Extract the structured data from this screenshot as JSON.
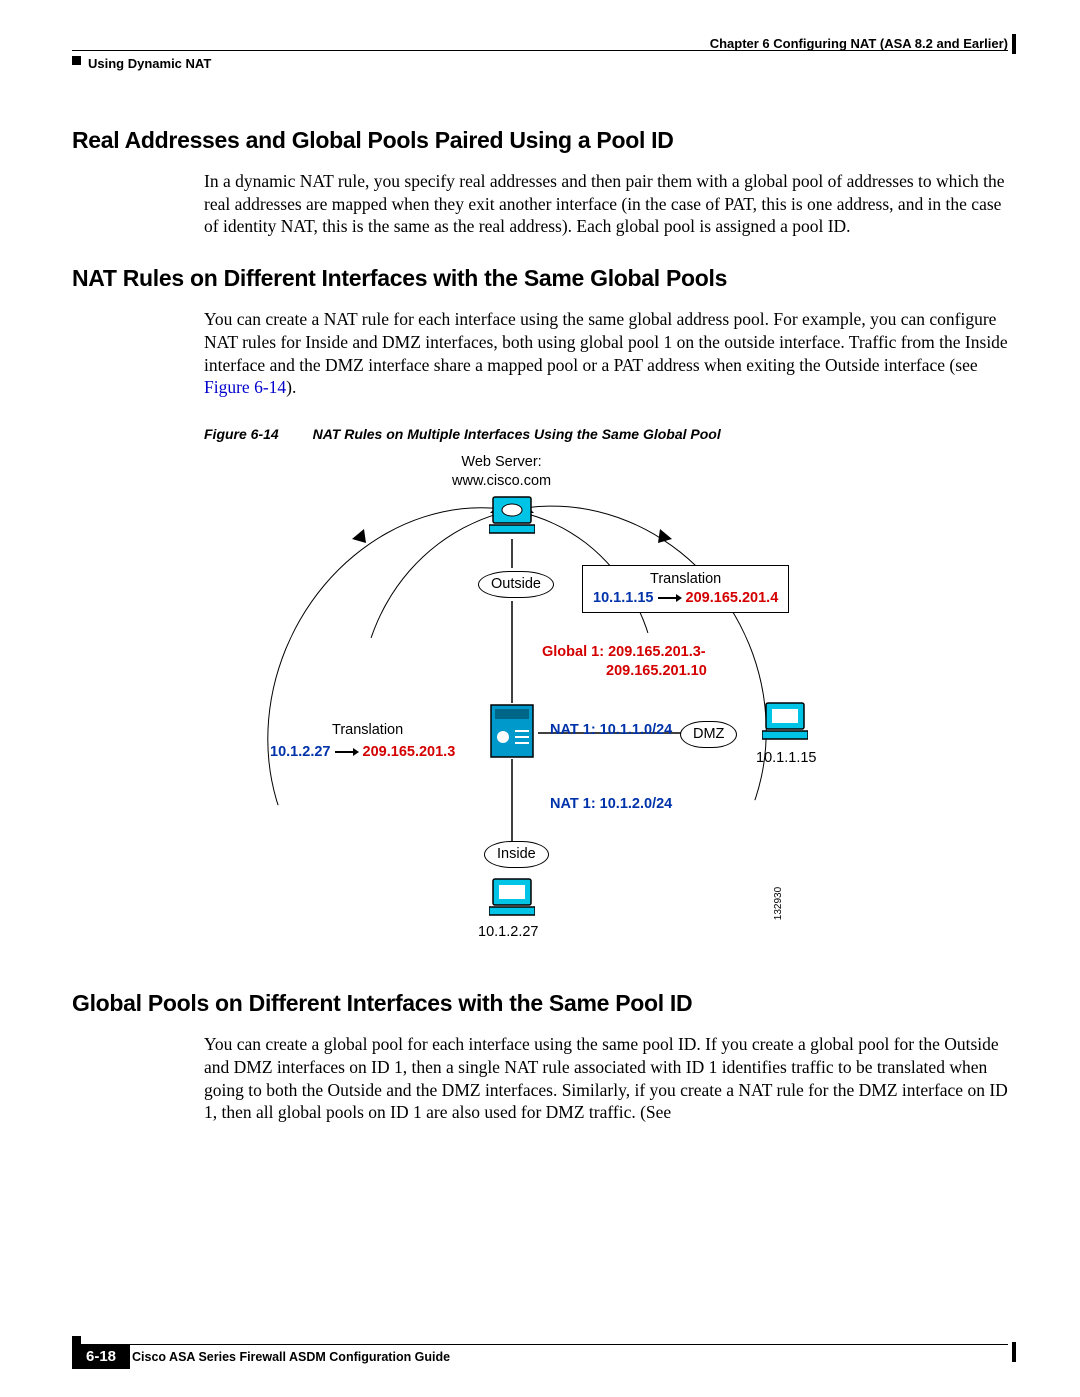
{
  "header": {
    "chapter": "Chapter 6      Configuring NAT (ASA 8.2 and Earlier)",
    "section": "Using Dynamic NAT"
  },
  "sections": {
    "s1": {
      "title": "Real Addresses and Global Pools Paired Using a Pool ID",
      "body": "In a dynamic NAT rule, you specify real addresses and then pair them with a global pool of addresses to which the real addresses are mapped when they exit another interface (in the case of PAT, this is one address, and in the case of identity NAT, this is the same as the real address). Each global pool is assigned a pool ID."
    },
    "s2": {
      "title": "NAT Rules on Different Interfaces with the Same Global Pools",
      "body_pre": "You can create a NAT rule for each interface using the same global address pool. For example, you can configure NAT rules for Inside and DMZ interfaces, both using global pool 1 on the outside interface. Traffic from the Inside interface and the DMZ interface share a mapped pool or a PAT address when exiting the Outside interface (see ",
      "body_link": "Figure 6-14",
      "body_post": ")."
    },
    "figure": {
      "num": "Figure 6-14",
      "caption": "NAT Rules on Multiple Interfaces Using the Same Global Pool",
      "webserver_top": "Web Server:",
      "webserver_url": "www.cisco.com",
      "outside": "Outside",
      "dmz": "DMZ",
      "inside": "Inside",
      "trans_label": "Translation",
      "trans_right_src": "10.1.1.15",
      "trans_right_dst": "209.165.201.4",
      "global1_a": "Global 1: 209.165.201.3-",
      "global1_b": "209.165.201.10",
      "nat1a": "NAT 1: 10.1.1.0/24",
      "nat1b": "NAT 1: 10.1.2.0/24",
      "trans_left_src": "10.1.2.27",
      "trans_left_dst": "209.165.201.3",
      "dmz_ip": "10.1.1.15",
      "inside_ip": "10.1.2.27",
      "diag_id": "132930"
    },
    "s3": {
      "title": "Global Pools on Different Interfaces with the Same Pool ID",
      "body": "You can create a global pool for each interface using the same pool ID. If you create a global pool for the Outside and DMZ interfaces on ID 1, then a single NAT rule associated with ID 1 identifies traffic to be translated when going to both the Outside and the DMZ interfaces. Similarly, if you create a NAT rule for the DMZ interface on ID 1, then all global pools on ID 1 are also used for DMZ traffic. (See"
    }
  },
  "footer": {
    "guide": "Cisco ASA Series Firewall ASDM Configuration Guide",
    "page": "6-18"
  }
}
